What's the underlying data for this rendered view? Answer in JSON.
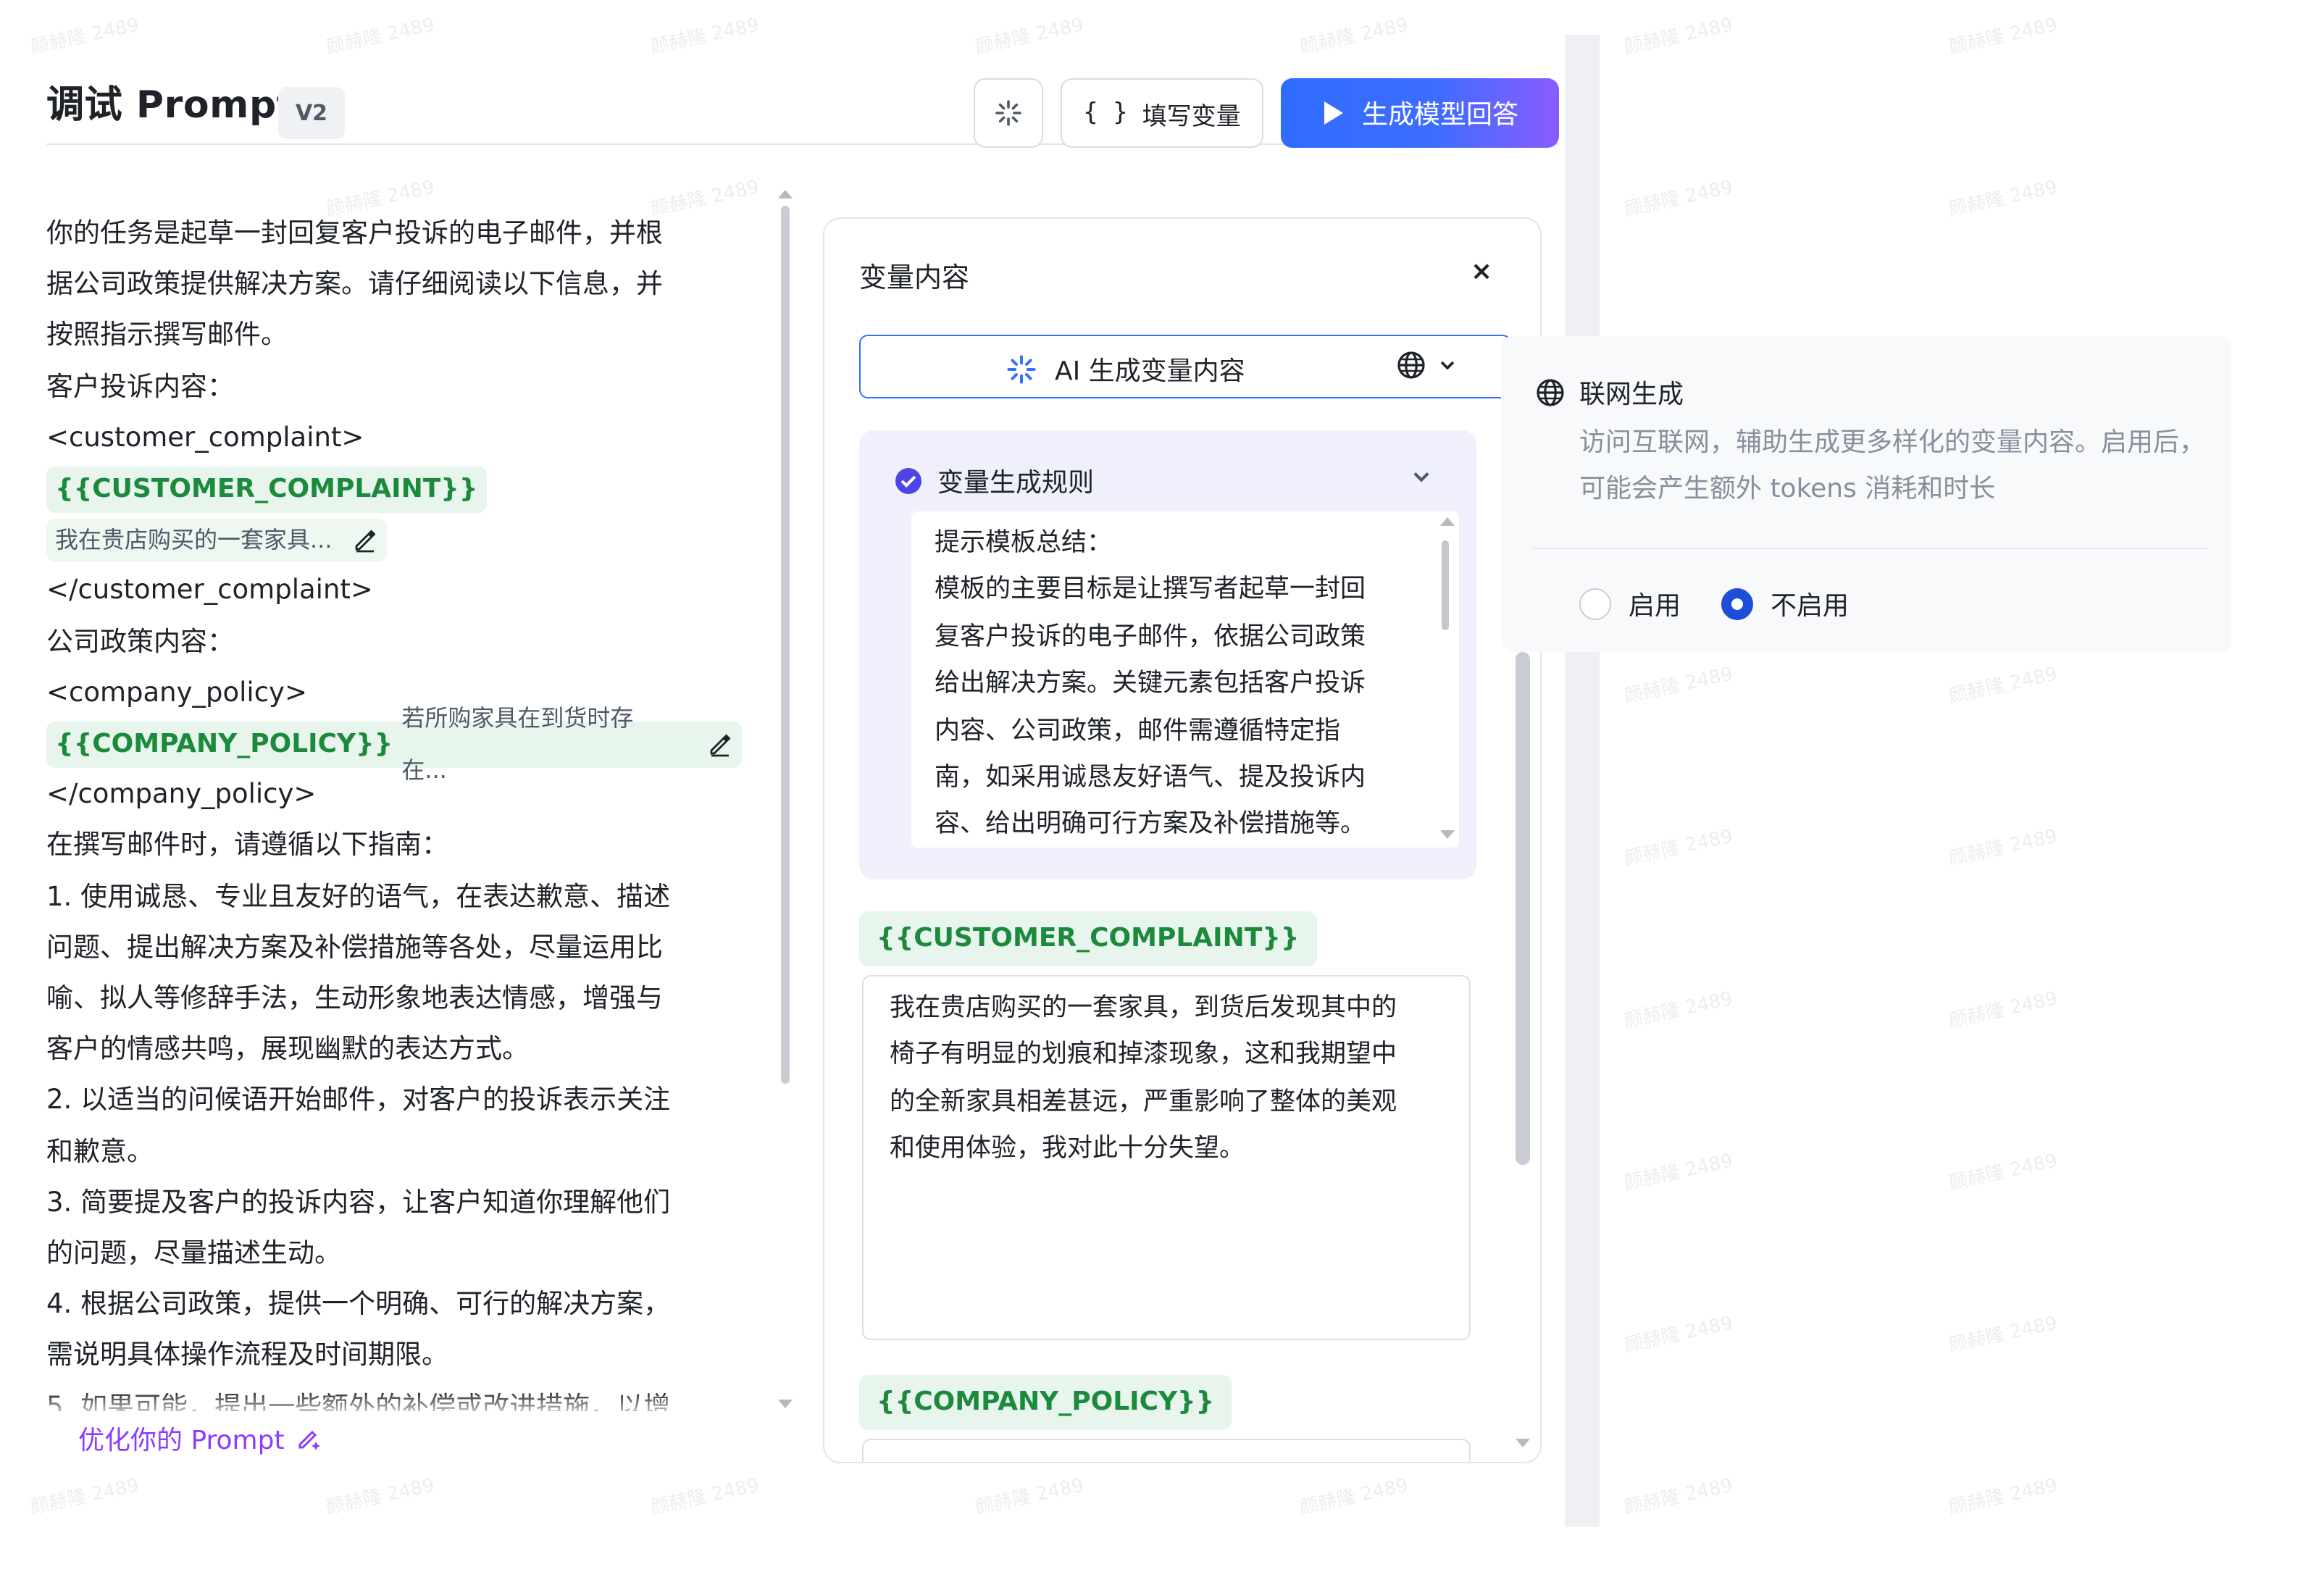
{
  "header": {
    "title": "调试 Prompt",
    "version": "V2",
    "fill_variables_label": "填写变量",
    "generate_label": "生成模型回答"
  },
  "prompt": {
    "lines": [
      "你的任务是起草一封回复客户投诉的电子邮件，并根",
      "据公司政策提供解决方案。请仔细阅读以下信息，并",
      "按照指示撰写邮件。",
      "客户投诉内容：",
      "<customer_complaint>"
    ],
    "var1": "{{CUSTOMER_COMPLAINT}}",
    "var1_value": "我在贵店购买的一套家具...",
    "lines2": [
      "</customer_complaint>",
      "公司政策内容：",
      "<company_policy>"
    ],
    "var2": "{{COMPANY_POLICY}}",
    "var2_value": "若所购家具在到货时存在...",
    "lines3": [
      "</company_policy>",
      "在撰写邮件时，请遵循以下指南：",
      "1. 使用诚恳、专业且友好的语气，在表达歉意、描述",
      "问题、提出解决方案及补偿措施等各处，尽量运用比",
      "喻、拟人等修辞手法，生动形象地表达情感，增强与",
      "客户的情感共鸣，展现幽默的表达方式。",
      "2. 以适当的问候语开始邮件，对客户的投诉表示关注",
      "和歉意。",
      "3. 简要提及客户的投诉内容，让客户知道你理解他们",
      "的问题，尽量描述生动。",
      "4. 根据公司政策，提供一个明确、可行的解决方案，",
      "需说明具体操作流程及时间期限。",
      "5. 如果可能，提出一些额外的补偿或改进措施，以增"
    ],
    "optimize_label": "优化你的 Prompt"
  },
  "variables_panel": {
    "title": "变量内容",
    "close": "×",
    "ai_generate_label": "AI 生成变量内容",
    "rules": {
      "title": "变量生成规则",
      "text": [
        "提示模板总结：",
        "模板的主要目标是让撰写者起草一封回",
        "复客户投诉的电子邮件，依据公司政策",
        "给出解决方案。关键元素包括客户投诉",
        "内容、公司政策，邮件需遵循特定指",
        "南，如采用诚恳友好语气、提及投诉内",
        "容、给出明确可行方案及补偿措施等。"
      ]
    },
    "var1_tag": "{{CUSTOMER_COMPLAINT}}",
    "var1_text": [
      "我在贵店购买的一套家具，到货后发现其中的",
      "椅子有明显的划痕和掉漆现象，这和我期望中",
      "的全新家具相差甚远，严重影响了整体的美观",
      "和使用体验，我对此十分失望。"
    ],
    "var2_tag": "{{COMPANY_POLICY}}"
  },
  "popover": {
    "title": "联网生成",
    "description": "访问互联网，辅助生成更多样化的变量内容。启用后，可能会产生额外 tokens 消耗和时长",
    "option_on": "启用",
    "option_off": "不启用",
    "selected": "不启用"
  },
  "colors": {
    "accent_blue": "#3370ff",
    "variable_green": "#1c8a3c",
    "optimize_purple": "#8b3dff"
  },
  "watermark_text": "颜赫隆 2489"
}
